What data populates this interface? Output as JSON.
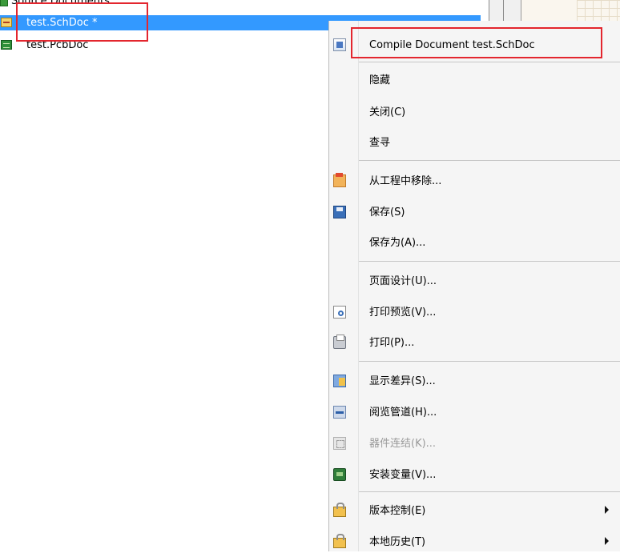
{
  "tree": {
    "folder_label": "Source Documents",
    "items": [
      {
        "label": "test.SchDoc *"
      },
      {
        "label": "test.PcbDoc"
      }
    ]
  },
  "menu": {
    "items": [
      {
        "label": "Compile Document test.SchDoc",
        "icon": "compile-icon"
      },
      {
        "label": "隐藏"
      },
      {
        "label": "关闭(C)"
      },
      {
        "label": "查寻"
      },
      {
        "label": "从工程中移除...",
        "icon": "remove-from-project-icon"
      },
      {
        "label": "保存(S)",
        "icon": "save-icon"
      },
      {
        "label": "保存为(A)..."
      },
      {
        "label": "页面设计(U)..."
      },
      {
        "label": "打印预览(V)...",
        "icon": "print-preview-icon"
      },
      {
        "label": "打印(P)...",
        "icon": "print-icon"
      },
      {
        "label": "显示差异(S)...",
        "icon": "show-differences-icon"
      },
      {
        "label": "阅览管道(H)...",
        "icon": "view-channels-icon"
      },
      {
        "label": "器件连结(K)...",
        "icon": "component-links-icon",
        "disabled": true
      },
      {
        "label": "安装变量(V)...",
        "icon": "assembly-variants-icon"
      },
      {
        "label": "版本控制(E)",
        "icon": "lock-icon",
        "submenu": true
      },
      {
        "label": "本地历史(T)",
        "icon": "lock-icon",
        "submenu": true
      }
    ]
  },
  "colors": {
    "selection": "#3399ff",
    "highlight_box": "#e3262e",
    "menu_background": "#f5f5f5"
  }
}
